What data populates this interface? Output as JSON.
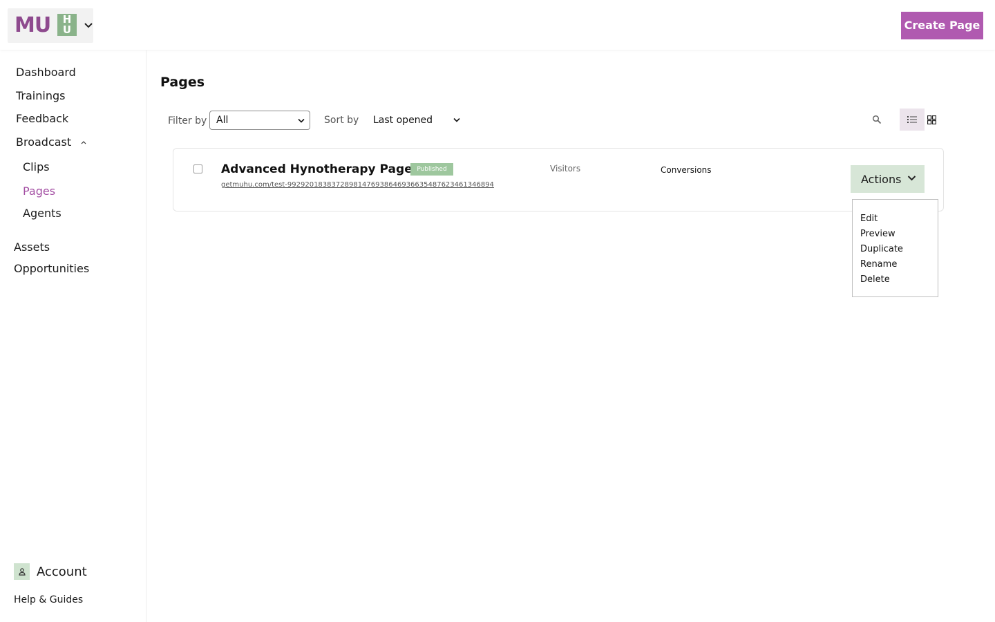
{
  "header": {
    "logo_text": "MU",
    "logo_block_text": "H U",
    "create_button": "Create Page"
  },
  "sidebar": {
    "items": [
      {
        "label": "Dashboard"
      },
      {
        "label": "Trainings"
      },
      {
        "label": "Feedback"
      },
      {
        "label": "Broadcast"
      },
      {
        "label": "Clips"
      },
      {
        "label": "Pages"
      },
      {
        "label": "Agents"
      },
      {
        "label": "Assets"
      },
      {
        "label": "Opportunities"
      }
    ],
    "active_item": "Pages",
    "account_label": "Account",
    "help_label": "Help & Guides"
  },
  "main": {
    "title": "Pages",
    "filter_label": "Filter by",
    "filter_value": "All",
    "sort_label": "Sort by",
    "sort_value": "Last opened",
    "view_mode": "list"
  },
  "pages": [
    {
      "title": "Advanced Hynotherapy Page",
      "status": "Published",
      "url": "getmuhu.com/test-992920183837289814769386469366354876234613468 94",
      "visitors_label": "Visitors",
      "conversions_label": "Conversions",
      "actions_label": "Actions"
    }
  ],
  "actions_menu": {
    "items": [
      "Edit",
      "Preview",
      "Duplicate",
      "Rename",
      "Delete"
    ]
  },
  "colors": {
    "brand": "#b05ab0",
    "active_nav": "#a34ea3",
    "badge": "#9ec79e",
    "actions_bg": "#d7e6d7",
    "account_icon_bg": "#cfe3cf"
  }
}
